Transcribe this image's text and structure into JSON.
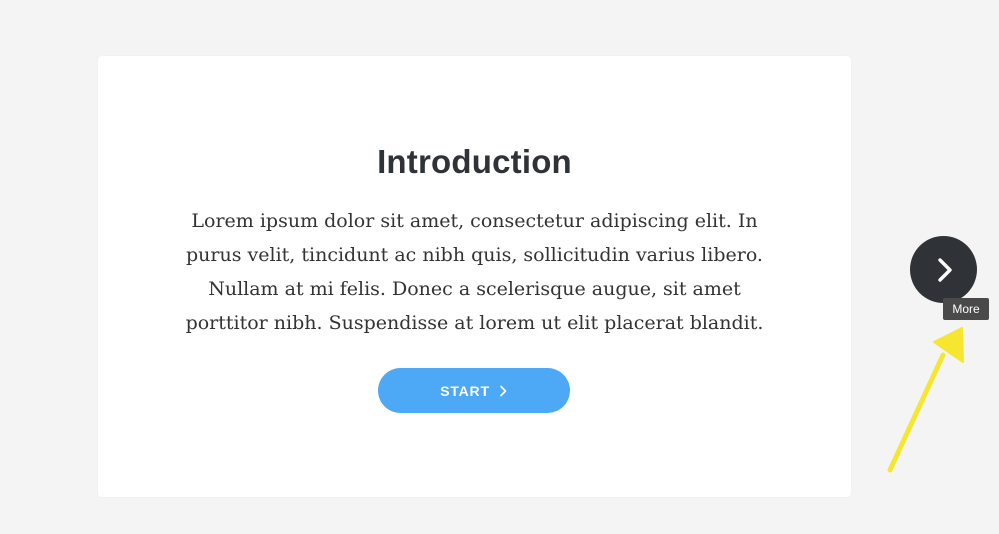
{
  "card": {
    "title": "Introduction",
    "body": "Lorem ipsum dolor sit amet, consectetur adipiscing elit. In purus velit, tincidunt ac nibh quis, sollicitudin varius libero. Nullam at mi felis. Donec a scelerisque augue, sit amet porttitor nibh. Suspendisse at lorem ut elit placerat blandit.",
    "start_button_label": "START",
    "start_button_icon": "chevron-right-icon"
  },
  "navigation": {
    "next_button_icon": "chevron-right-icon",
    "tooltip": "More"
  },
  "annotation": {
    "arrow_icon": "arrow-icon"
  },
  "colors": {
    "background": "#f4f4f4",
    "card_background": "#ffffff",
    "title_text": "#2f3237",
    "accent_button": "#4da9f5",
    "next_button": "#2f3338",
    "tooltip_background": "#4a4a4a",
    "annotation_arrow": "#f7e630"
  }
}
